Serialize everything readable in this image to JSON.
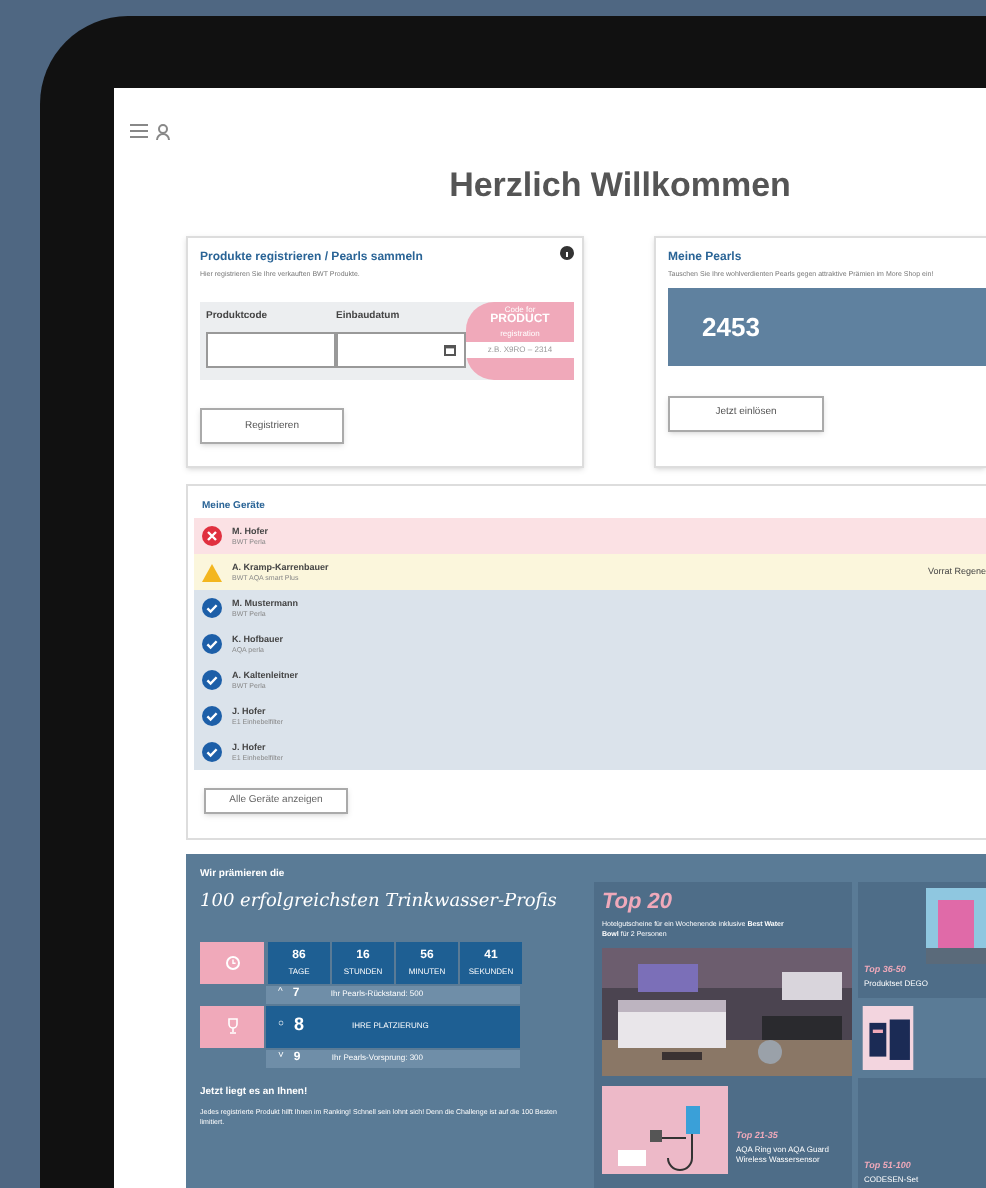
{
  "header": {
    "title": "Herzlich Willkommen"
  },
  "register": {
    "title": "Produkte registrieren / Pearls sammeln",
    "subtitle": "Hier registrieren Sie Ihre verkauften BWT Produkte.",
    "fields": [
      {
        "label": "Produktcode",
        "kind": "text"
      },
      {
        "label": "Einbaudatum",
        "kind": "date"
      }
    ],
    "promo": {
      "line_1": "Code for",
      "line_2": "PRODUCT",
      "line_3": "registration",
      "placeholder": "z.B. X9RO – 2314"
    },
    "button": "Registrieren"
  },
  "pearls": {
    "title": "Meine Pearls",
    "subtitle": "Tauschen Sie Ihre wohlverdienten Pearls gegen attraktive Prämien im More Shop ein!",
    "value": "2453",
    "button": "Jetzt einlösen"
  },
  "devices": {
    "title": "Meine Geräte",
    "rows": [
      {
        "name": "M. Hofer",
        "product": "BWT Perla",
        "kind": "error"
      },
      {
        "name": "A. Kramp-Karrenbauer",
        "product": "BWT AQA smart Plus",
        "kind": "warning",
        "note": "Vorrat Regene"
      },
      {
        "name": "M. Mustermann",
        "product": "BWT Perla",
        "kind": "ok"
      },
      {
        "name": "K. Hofbauer",
        "product": "AQA perla",
        "kind": "ok"
      },
      {
        "name": "A. Kaltenleitner",
        "product": "BWT Perla",
        "kind": "ok"
      },
      {
        "name": "J. Hofer",
        "product": "E1 Einhebelfilter",
        "kind": "ok"
      },
      {
        "name": "J. Hofer",
        "product": "E1 Einhebelfilter",
        "kind": "ok"
      }
    ],
    "button": "Alle Geräte anzeigen"
  },
  "challenge": {
    "kicker": "Wir prämieren die",
    "headline": "100 erfolgreichsten Trinkwasser-Profis",
    "countdown": [
      {
        "value": "86",
        "unit": "TAGE"
      },
      {
        "value": "16",
        "unit": "STUNDEN"
      },
      {
        "value": "56",
        "unit": "MINUTEN"
      },
      {
        "value": "41",
        "unit": "SEKUNDEN"
      }
    ],
    "ranks": [
      {
        "kind": "above",
        "symbol": "^",
        "rank": "7",
        "text": "Ihr Pearls-Rückstand: 500"
      },
      {
        "kind": "current",
        "symbol": "○",
        "rank": "8",
        "text": "IHRE PLATZIERUNG"
      },
      {
        "kind": "below",
        "symbol": "˅",
        "rank": "9",
        "text": "Ihr Pearls-Vorsprung: 300"
      }
    ],
    "call_title": "Jetzt liegt es an Ihnen!",
    "call_text": "Jedes registrierte Produkt hilft Ihnen im Ranking! Schnell sein lohnt sich! Denn die Challenge ist auf die 100 Besten limitiert."
  },
  "prizes": {
    "main": {
      "title": "Top 20",
      "subtitle": "Hotelgutscheine für ein Wochenende inklusive **Best Water Bowl** für 2 Personen"
    },
    "second": {
      "title": "Top 21-35",
      "subtitle": "AQA Ring von AQA Guard Wireless Wassersensor"
    },
    "side": [
      {
        "title": "Top 36-50",
        "subtitle": "Produktset DEGO"
      },
      {
        "title": "Top 51-100",
        "subtitle": "CODESEN-Set"
      }
    ]
  }
}
